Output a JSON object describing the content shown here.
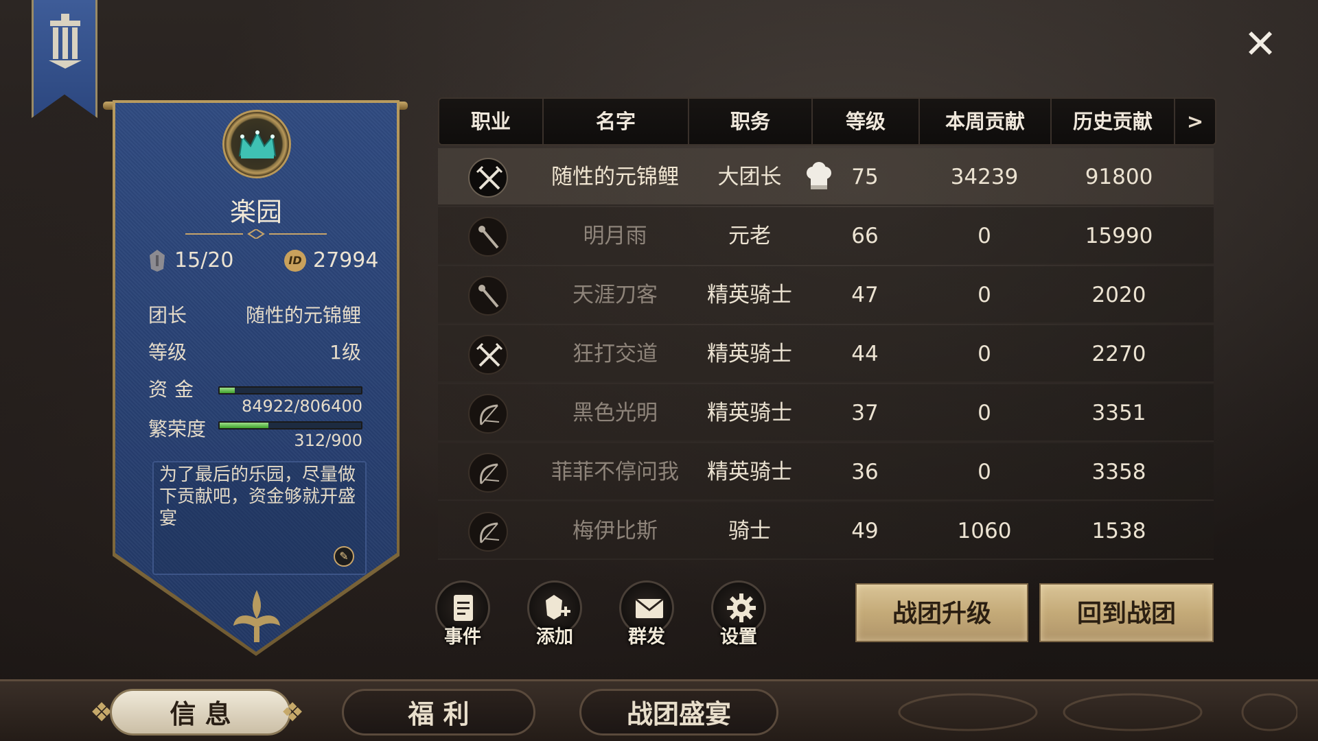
{
  "guild": {
    "name": "楽园",
    "members": "15/20",
    "id": "27994",
    "id_badge": "ID",
    "leader_label": "团长",
    "leader_value": "随性的元锦鲤",
    "level_label": "等级",
    "level_value": "1级",
    "funds_label": "资金",
    "funds_value": "84922/806400",
    "funds_ratio": 0.105,
    "prosperity_label": "繁荣度",
    "prosperity_value": "312/900",
    "prosperity_ratio": 0.347,
    "notice": "为了最后的乐园，尽量做下贡献吧，资金够就开盛宴"
  },
  "table": {
    "headers": [
      "职业",
      "名字",
      "职务",
      "等级",
      "本周贡献",
      "历史贡献"
    ],
    "more": ">",
    "rows": [
      {
        "job_icon": "crossed-swords-icon",
        "name": "随性的元锦鲤",
        "role": "大团长",
        "level": "75",
        "weekly": "34239",
        "total": "91800",
        "online": true
      },
      {
        "job_icon": "staff-icon",
        "name": "明月雨",
        "role": "元老",
        "level": "66",
        "weekly": "0",
        "total": "15990",
        "online": false
      },
      {
        "job_icon": "staff-icon",
        "name": "天涯刀客",
        "role": "精英骑士",
        "level": "47",
        "weekly": "0",
        "total": "2020",
        "online": false
      },
      {
        "job_icon": "crossed-swords-icon",
        "name": "狂打交道",
        "role": "精英骑士",
        "level": "44",
        "weekly": "0",
        "total": "2270",
        "online": false
      },
      {
        "job_icon": "bow-icon",
        "name": "黑色光明",
        "role": "精英骑士",
        "level": "37",
        "weekly": "0",
        "total": "3351",
        "online": false
      },
      {
        "job_icon": "bow-icon",
        "name": "菲菲不停问我",
        "role": "精英骑士",
        "level": "36",
        "weekly": "0",
        "total": "3358",
        "online": false
      },
      {
        "job_icon": "bow-icon",
        "name": "梅伊比斯",
        "role": "骑士",
        "level": "49",
        "weekly": "1060",
        "total": "1538",
        "online": false
      }
    ]
  },
  "actions": {
    "events": "事件",
    "add": "添加",
    "mass_mail": "群发",
    "settings": "设置"
  },
  "buttons": {
    "upgrade": "战团升级",
    "return": "回到战团"
  },
  "tabs": [
    "信 息",
    "福 利",
    "战团盛宴"
  ],
  "close": "✕",
  "colors": {
    "banner_blue": "#2f4a80",
    "gold": "#c7a46a",
    "bar_green": "#3fa12c"
  }
}
